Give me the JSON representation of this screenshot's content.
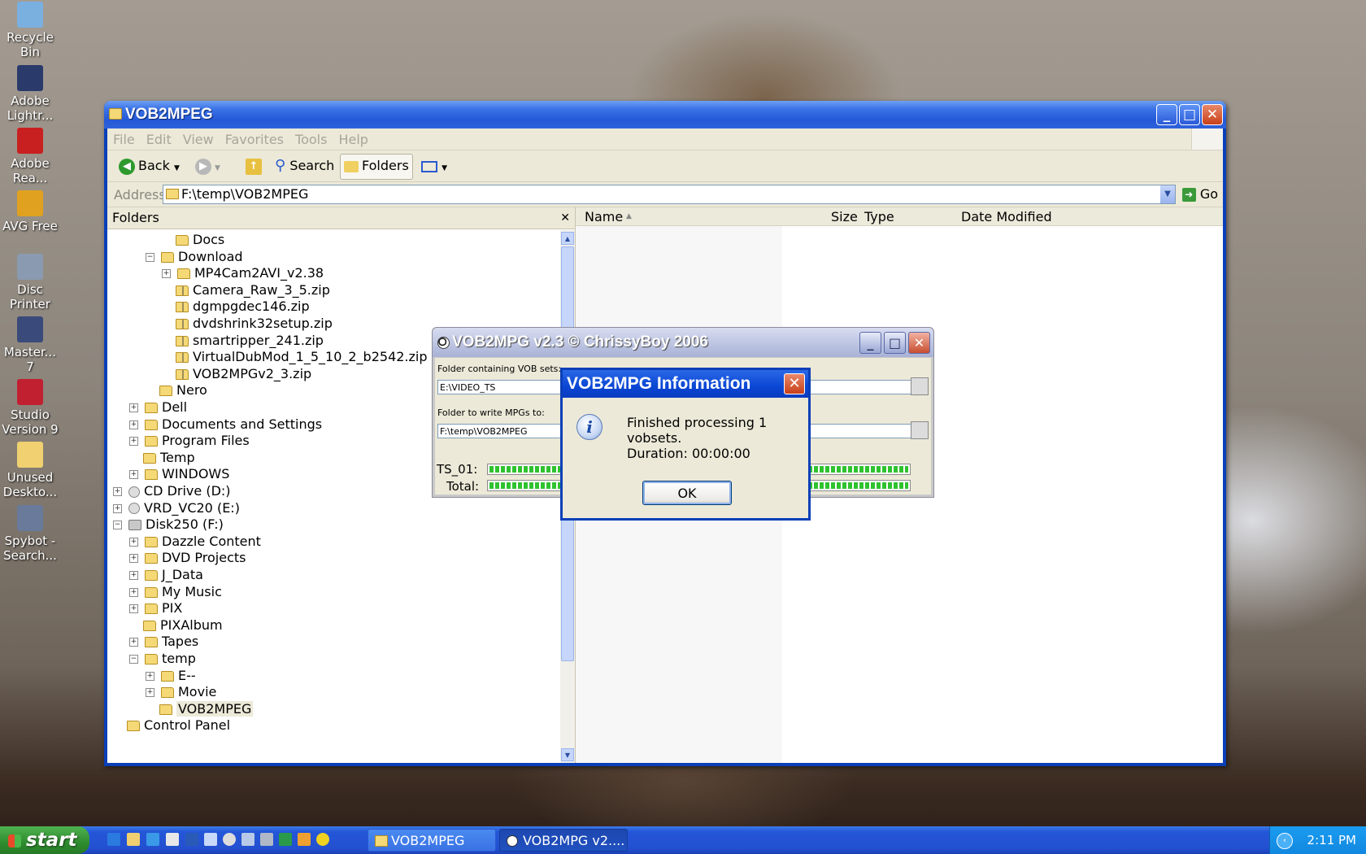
{
  "desktop": {
    "icons": [
      {
        "label": "Recycle Bin",
        "icon": "recycle-bin-icon",
        "color": "#7ab0e0"
      },
      {
        "label": "Adobe Lightr...",
        "icon": "adobe-lightroom-icon",
        "color": "#2a3a6a"
      },
      {
        "label": "Adobe Rea...",
        "icon": "adobe-reader-icon",
        "color": "#c82020"
      },
      {
        "label": "AVG Free",
        "icon": "avg-icon",
        "color": "#e0a020"
      },
      {
        "label": "Disc Printer",
        "icon": "disc-printer-icon",
        "color": "#8a9ab0"
      },
      {
        "label": "Master... 7",
        "icon": "master-collection-icon",
        "color": "#3a4a7a"
      },
      {
        "label": "Studio Version 9",
        "icon": "studio-icon",
        "color": "#c02030"
      },
      {
        "label": "Unused Deskto...",
        "icon": "folder-icon",
        "color": "#f0d070"
      },
      {
        "label": "Spybot - Search...",
        "icon": "spybot-icon",
        "color": "#6a7a9a"
      }
    ]
  },
  "explorer": {
    "title": "VOB2MPEG",
    "menu": [
      "File",
      "Edit",
      "View",
      "Favorites",
      "Tools",
      "Help"
    ],
    "toolbar": {
      "back": "Back",
      "search": "Search",
      "folders": "Folders"
    },
    "address": {
      "label": "Address",
      "value": "F:\\temp\\VOB2MPEG",
      "go": "Go"
    },
    "folders_pane": {
      "header": "Folders",
      "items": [
        {
          "label": "Docs",
          "expander": "",
          "type": "folder"
        },
        {
          "label": "Download",
          "expander": "−",
          "type": "folder"
        },
        {
          "label": "MP4Cam2AVI_v2.38",
          "expander": "+",
          "type": "folder"
        },
        {
          "label": "Camera_Raw_3_5.zip",
          "expander": "",
          "type": "zip"
        },
        {
          "label": "dgmpgdec146.zip",
          "expander": "",
          "type": "zip"
        },
        {
          "label": "dvdshrink32setup.zip",
          "expander": "",
          "type": "zip"
        },
        {
          "label": "smartripper_241.zip",
          "expander": "",
          "type": "zip"
        },
        {
          "label": "VirtualDubMod_1_5_10_2_b2542.zip",
          "expander": "",
          "type": "zip"
        },
        {
          "label": "VOB2MPGv2_3.zip",
          "expander": "",
          "type": "zip"
        },
        {
          "label": "Nero",
          "expander": "",
          "type": "folder"
        },
        {
          "label": "Dell",
          "expander": "+",
          "type": "folder"
        },
        {
          "label": "Documents and Settings",
          "expander": "+",
          "type": "folder"
        },
        {
          "label": "Program Files",
          "expander": "+",
          "type": "folder"
        },
        {
          "label": "Temp",
          "expander": "",
          "type": "folder"
        },
        {
          "label": "WINDOWS",
          "expander": "+",
          "type": "folder"
        },
        {
          "label": "CD Drive (D:)",
          "expander": "+",
          "type": "cd"
        },
        {
          "label": "VRD_VC20 (E:)",
          "expander": "+",
          "type": "cd"
        },
        {
          "label": "Disk250 (F:)",
          "expander": "−",
          "type": "drive"
        },
        {
          "label": "Dazzle Content",
          "expander": "+",
          "type": "folder"
        },
        {
          "label": "DVD Projects",
          "expander": "+",
          "type": "folder"
        },
        {
          "label": "J_Data",
          "expander": "+",
          "type": "folder"
        },
        {
          "label": "My Music",
          "expander": "+",
          "type": "folder"
        },
        {
          "label": "PIX",
          "expander": "+",
          "type": "folder"
        },
        {
          "label": "PIXAlbum",
          "expander": "",
          "type": "folder"
        },
        {
          "label": "Tapes",
          "expander": "+",
          "type": "folder"
        },
        {
          "label": "temp",
          "expander": "−",
          "type": "folder"
        },
        {
          "label": "E--",
          "expander": "+",
          "type": "folder"
        },
        {
          "label": "Movie",
          "expander": "+",
          "type": "folder"
        },
        {
          "label": "VOB2MPEG",
          "expander": "",
          "type": "folder",
          "selected": true
        },
        {
          "label": "Control Panel",
          "expander": "",
          "type": "folder"
        }
      ]
    },
    "file_list": {
      "columns": [
        "Name",
        "Size",
        "Type",
        "Date Modified"
      ]
    }
  },
  "vob2mpg": {
    "title": "VOB2MPG v2.3 © ChrissyBoy 2006",
    "vob_label": "Folder containing VOB sets:",
    "vob_value": "E:\\VIDEO_TS",
    "mpg_label": "Folder to write MPGs to:",
    "mpg_value": "F:\\temp\\VOB2MPEG",
    "progress1_label": "TS_01:",
    "progress1": 1.0,
    "total_label": "Total:",
    "total": 1.0
  },
  "dialog": {
    "title": "VOB2MPG Information",
    "message": "Finished processing 1 vobsets.",
    "duration": "Duration: 00:00:00",
    "ok": "OK"
  },
  "taskbar": {
    "start": "start",
    "tasks": [
      {
        "label": "VOB2MPEG",
        "active": false
      },
      {
        "label": "VOB2MPG v2....",
        "active": true
      }
    ],
    "clock": "2:11 PM"
  }
}
